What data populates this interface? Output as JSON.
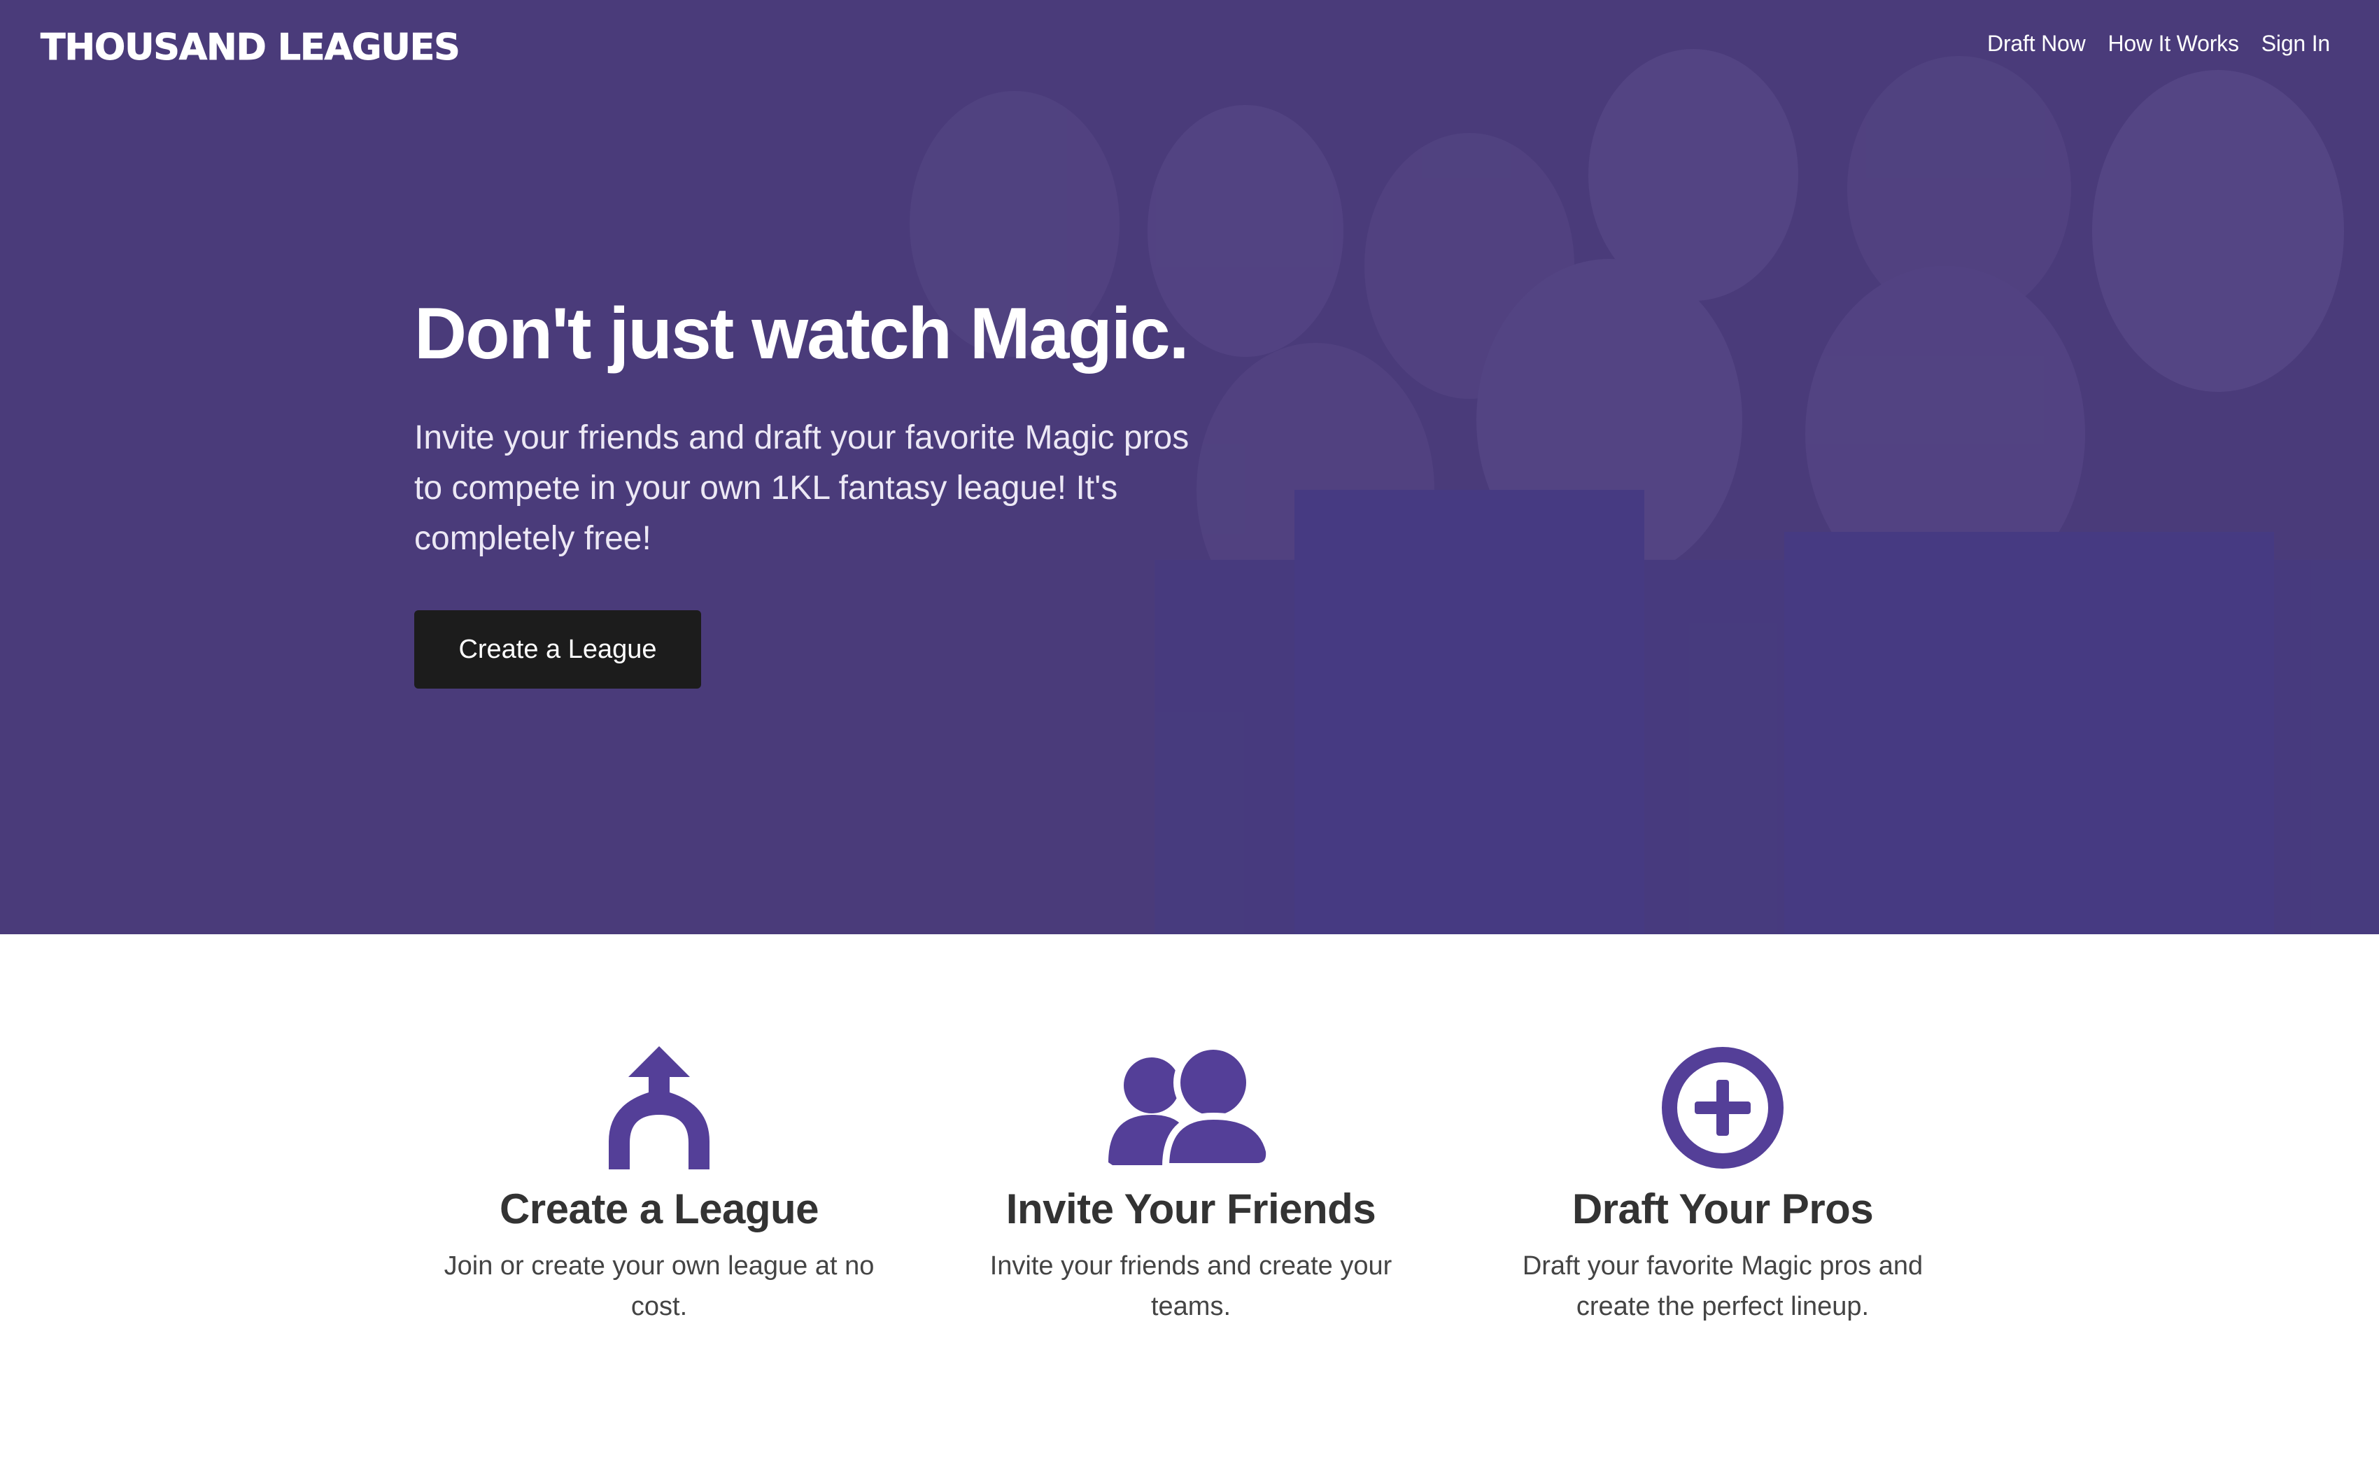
{
  "brand": {
    "name": "THOUSAND LEAGUES"
  },
  "nav": {
    "items": [
      {
        "label": "Draft Now"
      },
      {
        "label": "How It Works"
      },
      {
        "label": "Sign In"
      }
    ]
  },
  "hero": {
    "title": "Don't just watch Magic.",
    "subtitle": "Invite your friends and draft your favorite Magic pros to compete in your own 1KL fantasy league! It's completely free!",
    "cta_label": "Create a League"
  },
  "features": [
    {
      "icon": "merge-arrow-icon",
      "title": "Create a League",
      "text": "Join or create your own league at no cost."
    },
    {
      "icon": "users-icon",
      "title": "Invite Your Friends",
      "text": "Invite your friends and create your teams."
    },
    {
      "icon": "plus-circle-icon",
      "title": "Draft Your Pros",
      "text": "Draft your favorite Magic pros and create the perfect lineup."
    }
  ],
  "colors": {
    "hero_overlay": "#4a3b7a",
    "accent": "#543f98",
    "button_bg": "#1c1c1c",
    "heading_text": "#333333"
  }
}
